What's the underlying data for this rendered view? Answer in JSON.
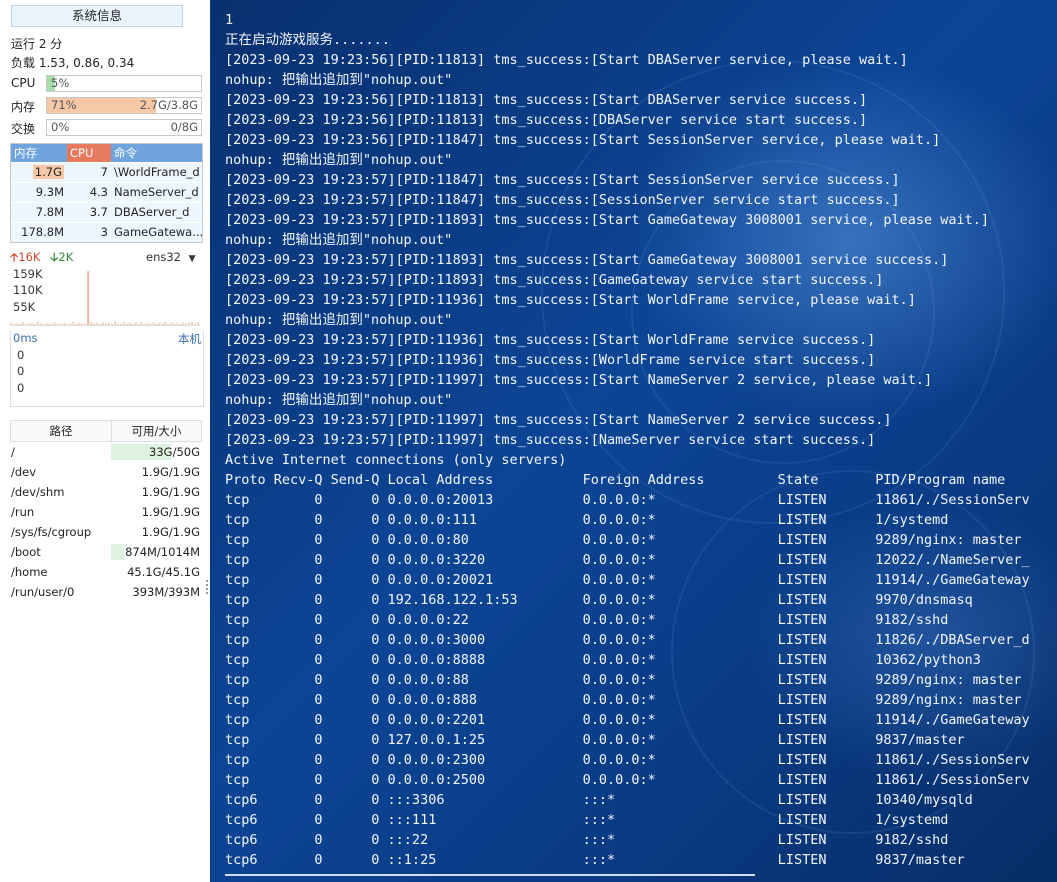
{
  "sidebar": {
    "title": "系统信息",
    "uptime": "运行 2 分",
    "load": "负载 1.53, 0.86, 0.34",
    "meters": [
      {
        "name": "CPU",
        "left": "5%",
        "right": "",
        "fraction": 0.05,
        "color": "#a8dca8"
      },
      {
        "name": "内存",
        "left": "71%",
        "right": "2.7G/3.8G",
        "fraction": 0.71,
        "color": "#f6c8a8"
      },
      {
        "name": "交换",
        "left": "0%",
        "right": "0/8G",
        "fraction": 0.0,
        "color": "#cfe3f6"
      }
    ],
    "process_table": {
      "headers": [
        "内存",
        "CPU",
        "命令"
      ],
      "header_colors": [
        "#6fa5dc",
        "#e57a5e",
        "#6fa5dc"
      ],
      "rows": [
        {
          "mem": "1.7G",
          "cpu": "7",
          "cmd": "\\WorldFrame_d"
        },
        {
          "mem": "9.3M",
          "cpu": "4.3",
          "cmd": "NameServer_d"
        },
        {
          "mem": "7.8M",
          "cpu": "3.7",
          "cmd": "DBAServer_d"
        },
        {
          "mem": "178.8M",
          "cpu": "3",
          "cmd": "GameGatewa..."
        }
      ]
    },
    "network": {
      "up": "16K",
      "down": "2K",
      "interface": "ens32",
      "y_labels": [
        "159K",
        "110K",
        "55K"
      ],
      "bars": [
        0.04,
        0.02,
        0.03,
        0.02,
        0.05,
        0.02,
        0.03,
        0.04,
        0.02,
        0.06,
        0.03,
        0.02,
        0.04,
        0.02,
        0.03,
        0.05,
        0.02,
        0.03,
        0.04,
        0.02,
        0.03,
        0.06,
        0.02,
        0.04,
        0.03,
        0.02,
        1.0,
        0.05,
        0.03,
        0.04,
        0.02,
        0.05,
        0.03,
        0.04,
        0.02,
        0.06,
        0.03,
        0.02,
        0.05,
        0.03,
        0.04,
        0.02,
        0.05,
        0.03,
        0.06,
        0.02,
        0.04,
        0.03,
        0.05,
        0.02,
        0.04,
        0.03,
        0.06,
        0.02,
        0.05,
        0.03,
        0.04,
        0.02,
        0.05,
        0.03,
        0.04,
        0.06,
        0.03,
        0.05
      ]
    },
    "latency": {
      "label": "0ms",
      "host": "本机",
      "values": [
        "0",
        "0",
        "0"
      ]
    },
    "disk": {
      "headers": [
        "路径",
        "可用/大小"
      ],
      "rows": [
        {
          "path": "/",
          "size": "33G/50G",
          "fraction": 0.66
        },
        {
          "path": "/dev",
          "size": "1.9G/1.9G",
          "fraction": 0.0
        },
        {
          "path": "/dev/shm",
          "size": "1.9G/1.9G",
          "fraction": 0.0
        },
        {
          "path": "/run",
          "size": "1.9G/1.9G",
          "fraction": 0.0
        },
        {
          "path": "/sys/fs/cgroup",
          "size": "1.9G/1.9G",
          "fraction": 0.0
        },
        {
          "path": "/boot",
          "size": "874M/1014M",
          "fraction": 0.14
        },
        {
          "path": "/home",
          "size": "45.1G/45.1G",
          "fraction": 0.0
        },
        {
          "path": "/run/user/0",
          "size": "393M/393M",
          "fraction": 0.0
        }
      ]
    }
  },
  "terminal": {
    "lines": [
      "1",
      "正在启动游戏服务.......",
      "[2023-09-23 19:23:56][PID:11813] tms_success:[Start DBAServer service, please wait.]",
      "nohup: 把输出追加到\"nohup.out\"",
      "[2023-09-23 19:23:56][PID:11813] tms_success:[Start DBAServer service success.]",
      "[2023-09-23 19:23:56][PID:11813] tms_success:[DBAServer service start success.]",
      "[2023-09-23 19:23:56][PID:11847] tms_success:[Start SessionServer service, please wait.]",
      "nohup: 把输出追加到\"nohup.out\"",
      "[2023-09-23 19:23:57][PID:11847] tms_success:[Start SessionServer service success.]",
      "[2023-09-23 19:23:57][PID:11847] tms_success:[SessionServer service start success.]",
      "[2023-09-23 19:23:57][PID:11893] tms_success:[Start GameGateway 3008001 service, please wait.]",
      "nohup: 把输出追加到\"nohup.out\"",
      "[2023-09-23 19:23:57][PID:11893] tms_success:[Start GameGateway 3008001 service success.]",
      "[2023-09-23 19:23:57][PID:11893] tms_success:[GameGateway service start success.]",
      "[2023-09-23 19:23:57][PID:11936] tms_success:[Start WorldFrame service, please wait.]",
      "nohup: 把输出追加到\"nohup.out\"",
      "[2023-09-23 19:23:57][PID:11936] tms_success:[Start WorldFrame service success.]",
      "[2023-09-23 19:23:57][PID:11936] tms_success:[WorldFrame service start success.]",
      "[2023-09-23 19:23:57][PID:11997] tms_success:[Start NameServer 2 service, please wait.]",
      "nohup: 把输出追加到\"nohup.out\"",
      "[2023-09-23 19:23:57][PID:11997] tms_success:[Start NameServer 2 service success.]",
      "[2023-09-23 19:23:57][PID:11997] tms_success:[NameServer service start success.]",
      "Active Internet connections (only servers)",
      "Proto Recv-Q Send-Q Local Address           Foreign Address         State       PID/Program name",
      "tcp        0      0 0.0.0.0:20013           0.0.0.0:*               LISTEN      11861/./SessionServ",
      "tcp        0      0 0.0.0.0:111             0.0.0.0:*               LISTEN      1/systemd",
      "tcp        0      0 0.0.0.0:80              0.0.0.0:*               LISTEN      9289/nginx: master",
      "tcp        0      0 0.0.0.0:3220            0.0.0.0:*               LISTEN      12022/./NameServer_",
      "tcp        0      0 0.0.0.0:20021           0.0.0.0:*               LISTEN      11914/./GameGateway",
      "tcp        0      0 192.168.122.1:53        0.0.0.0:*               LISTEN      9970/dnsmasq",
      "tcp        0      0 0.0.0.0:22              0.0.0.0:*               LISTEN      9182/sshd",
      "tcp        0      0 0.0.0.0:3000            0.0.0.0:*               LISTEN      11826/./DBAServer_d",
      "tcp        0      0 0.0.0.0:8888            0.0.0.0:*               LISTEN      10362/python3",
      "tcp        0      0 0.0.0.0:88              0.0.0.0:*               LISTEN      9289/nginx: master",
      "tcp        0      0 0.0.0.0:888             0.0.0.0:*               LISTEN      9289/nginx: master",
      "tcp        0      0 0.0.0.0:2201            0.0.0.0:*               LISTEN      11914/./GameGateway",
      "tcp        0      0 127.0.0.1:25            0.0.0.0:*               LISTEN      9837/master",
      "tcp        0      0 0.0.0.0:2300            0.0.0.0:*               LISTEN      11861/./SessionServ",
      "tcp        0      0 0.0.0.0:2500            0.0.0.0:*               LISTEN      11861/./SessionServ",
      "tcp6       0      0 :::3306                 :::*                    LISTEN      10340/mysqld",
      "tcp6       0      0 :::111                  :::*                    LISTEN      1/systemd",
      "tcp6       0      0 :::22                   :::*                    LISTEN      9182/sshd",
      "tcp6       0      0 ::1:25                  :::*                    LISTEN      9837/master"
    ]
  }
}
